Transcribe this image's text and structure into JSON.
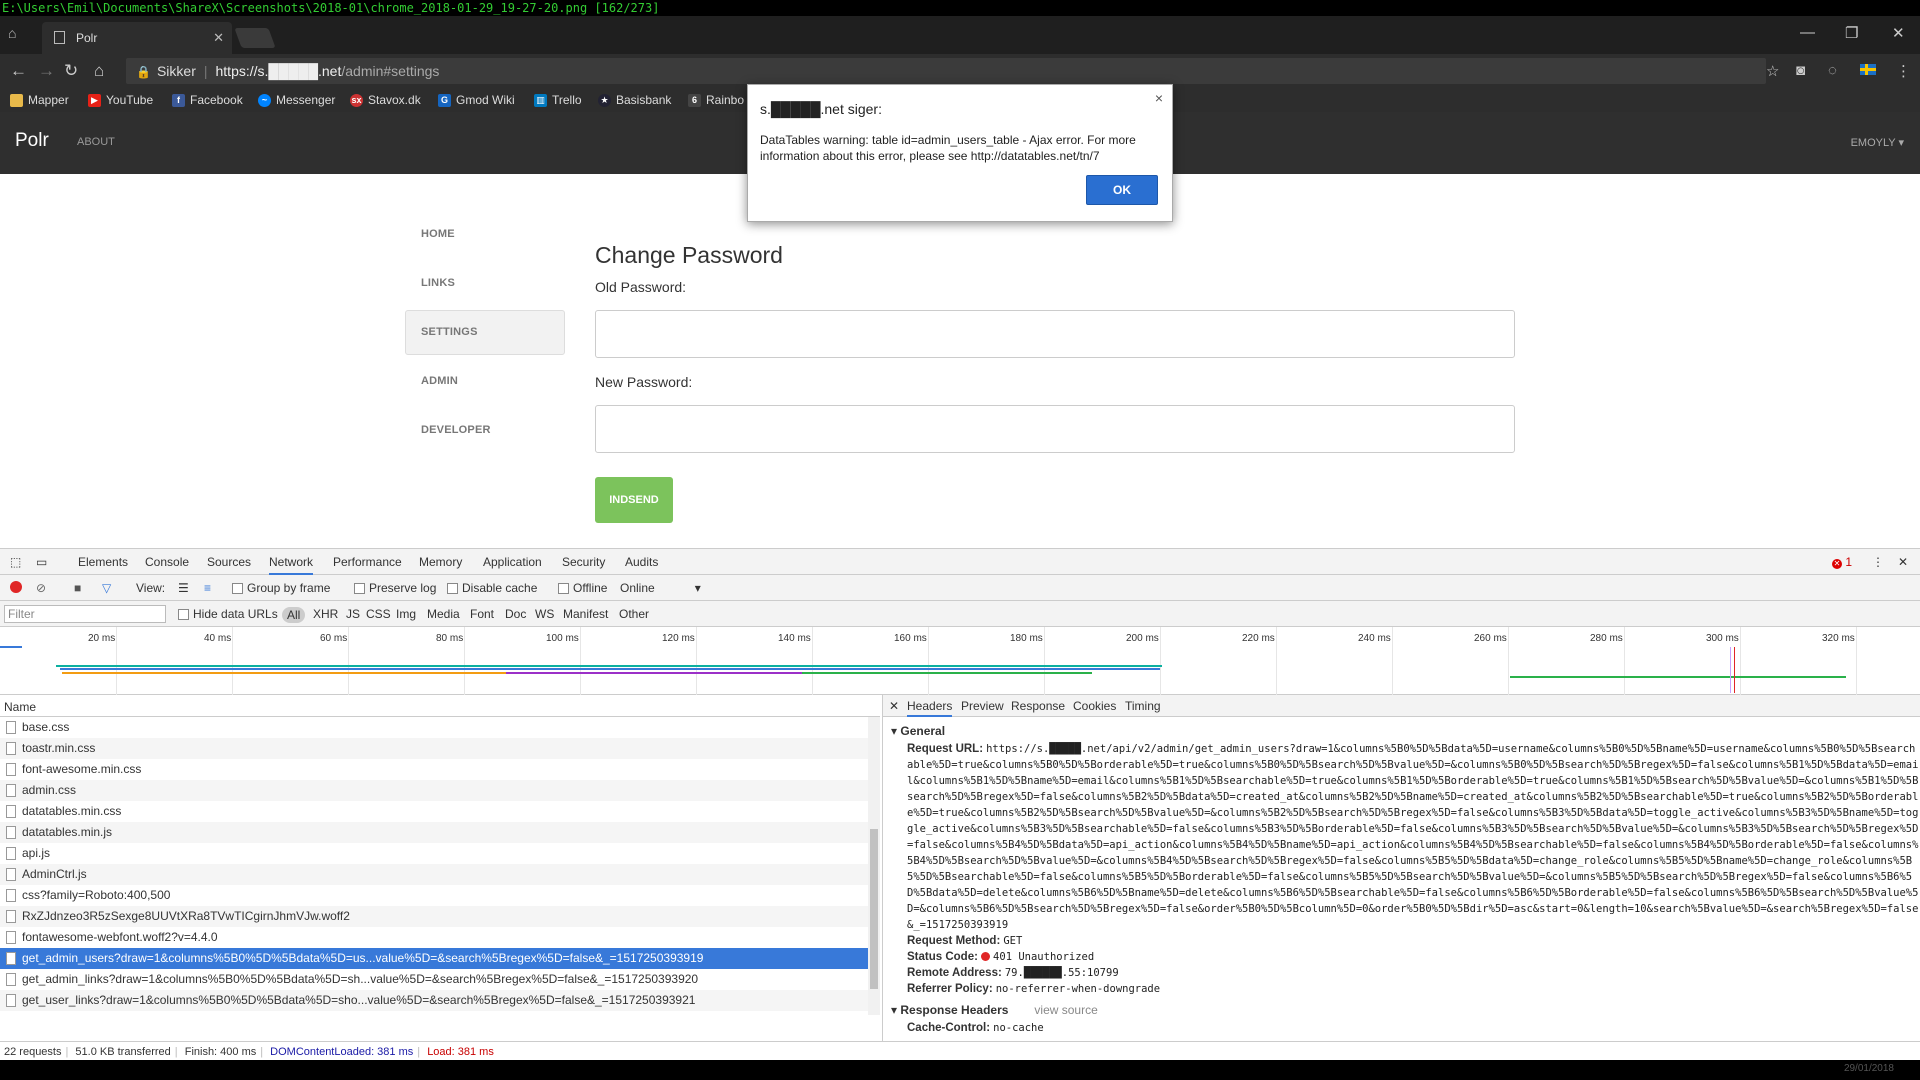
{
  "sharex_title": "E:\\Users\\Emil\\Documents\\ShareX\\Screenshots\\2018-01\\chrome_2018-01-29_19-27-20.png [162/273]",
  "browser": {
    "tab_title": "Polr",
    "tab_close": "✕",
    "secure_label": "Sikker",
    "url_host": "https://s.█████.net",
    "url_path": "/admin#settings",
    "bookmarks": [
      "Mapper",
      "YouTube",
      "Facebook",
      "Messenger",
      "Stavox.dk",
      "Gmod Wiki",
      "Trello",
      "Basisbank",
      "Rainbo"
    ]
  },
  "navbar": {
    "brand": "Polr",
    "about": "ABOUT",
    "user": "EMOYLY ▾"
  },
  "sidebar": {
    "items": [
      {
        "label": "HOME",
        "active": false
      },
      {
        "label": "LINKS",
        "active": false
      },
      {
        "label": "SETTINGS",
        "active": true
      },
      {
        "label": "ADMIN",
        "active": false
      },
      {
        "label": "DEVELOPER",
        "active": false
      }
    ]
  },
  "settings": {
    "title": "Change Password",
    "old_label": "Old Password:",
    "new_label": "New Password:",
    "submit": "INDSEND"
  },
  "dialog": {
    "title": "s.█████.net siger:",
    "close": "×",
    "message": "DataTables warning: table id=admin_users_table - Ajax error. For more information about this error, please see http://datatables.net/tn/7",
    "ok": "OK"
  },
  "devtools": {
    "tabs": [
      "Elements",
      "Console",
      "Sources",
      "Network",
      "Performance",
      "Memory",
      "Application",
      "Security",
      "Audits"
    ],
    "active_tab": "Network",
    "error_count": "1",
    "toolbar": {
      "view": "View:",
      "group_by_frame": "Group by frame",
      "preserve_log": "Preserve log",
      "disable_cache": "Disable cache",
      "offline": "Offline",
      "throttle": "Online"
    },
    "filter": {
      "placeholder": "Filter",
      "hide_data_urls": "Hide data URLs",
      "types": [
        "All",
        "XHR",
        "JS",
        "CSS",
        "Img",
        "Media",
        "Font",
        "Doc",
        "WS",
        "Manifest",
        "Other"
      ]
    },
    "timeline_ticks": [
      "20 ms",
      "40 ms",
      "60 ms",
      "80 ms",
      "100 ms",
      "120 ms",
      "140 ms",
      "160 ms",
      "180 ms",
      "200 ms",
      "220 ms",
      "240 ms",
      "260 ms",
      "280 ms",
      "300 ms",
      "320 ms"
    ],
    "list_header": "Name",
    "requests": [
      "base.css",
      "toastr.min.css",
      "font-awesome.min.css",
      "admin.css",
      "datatables.min.css",
      "datatables.min.js",
      "api.js",
      "AdminCtrl.js",
      "css?family=Roboto:400,500",
      "RxZJdnzeo3R5zSexge8UUVtXRa8TVwTICgirnJhmVJw.woff2",
      "fontawesome-webfont.woff2?v=4.4.0",
      "get_admin_users?draw=1&columns%5B0%5D%5Bdata%5D=us...value%5D=&search%5Bregex%5D=false&_=1517250393919",
      "get_admin_links?draw=1&columns%5B0%5D%5Bdata%5D=sh...value%5D=&search%5Bregex%5D=false&_=1517250393920",
      "get_user_links?draw=1&columns%5B0%5D%5Bdata%5D=sho...value%5D=&search%5Bregex%5D=false&_=1517250393921"
    ],
    "selected_request": 11,
    "summary": {
      "requests": "22 requests",
      "transferred": "51.0 KB transferred",
      "finish": "Finish: 400 ms",
      "domcontentloaded": "DOMContentLoaded: 381 ms",
      "load": "Load: 381 ms"
    },
    "detail": {
      "tabs": [
        "Headers",
        "Preview",
        "Response",
        "Cookies",
        "Timing"
      ],
      "general_title": "General",
      "request_url_label": "Request URL:",
      "request_url": "https://s.█████.net/api/v2/admin/get_admin_users?draw=1&columns%5B0%5D%5Bdata%5D=username&columns%5B0%5D%5Bname%5D=username&columns%5B0%5D%5Bsearchable%5D=true&columns%5B0%5D%5Borderable%5D=true&columns%5B0%5D%5Bsearch%5D%5Bvalue%5D=&columns%5B0%5D%5Bsearch%5D%5Bregex%5D=false&columns%5B1%5D%5Bdata%5D=email&columns%5B1%5D%5Bname%5D=email&columns%5B1%5D%5Bsearchable%5D=true&columns%5B1%5D%5Borderable%5D=true&columns%5B1%5D%5Bsearch%5D%5Bvalue%5D=&columns%5B1%5D%5Bsearch%5D%5Bregex%5D=false&columns%5B2%5D%5Bdata%5D=created_at&columns%5B2%5D%5Bname%5D=created_at&columns%5B2%5D%5Bsearchable%5D=true&columns%5B2%5D%5Borderable%5D=true&columns%5B2%5D%5Bsearch%5D%5Bvalue%5D=&columns%5B2%5D%5Bsearch%5D%5Bregex%5D=false&columns%5B3%5D%5Bdata%5D=toggle_active&columns%5B3%5D%5Bname%5D=toggle_active&columns%5B3%5D%5Bsearchable%5D=false&columns%5B3%5D%5Borderable%5D=false&columns%5B3%5D%5Bsearch%5D%5Bvalue%5D=&columns%5B3%5D%5Bsearch%5D%5Bregex%5D=false&columns%5B4%5D%5Bdata%5D=api_action&columns%5B4%5D%5Bname%5D=api_action&columns%5B4%5D%5Bsearchable%5D=false&columns%5B4%5D%5Borderable%5D=false&columns%5B4%5D%5Bsearch%5D%5Bvalue%5D=&columns%5B4%5D%5Bsearch%5D%5Bregex%5D=false&columns%5B5%5D%5Bdata%5D=change_role&columns%5B5%5D%5Bname%5D=change_role&columns%5B5%5D%5Bsearchable%5D=false&columns%5B5%5D%5Borderable%5D=false&columns%5B5%5D%5Bsearch%5D%5Bvalue%5D=&columns%5B5%5D%5Bsearch%5D%5Bregex%5D=false&columns%5B6%5D%5Bdata%5D=delete&columns%5B6%5D%5Bname%5D=delete&columns%5B6%5D%5Bsearchable%5D=false&columns%5B6%5D%5Borderable%5D=false&columns%5B6%5D%5Bsearch%5D%5Bvalue%5D=&columns%5B6%5D%5Bsearch%5D%5Bregex%5D=false&order%5B0%5D%5Bcolumn%5D=0&order%5B0%5D%5Bdir%5D=asc&start=0&length=10&search%5Bvalue%5D=&search%5Bregex%5D=false&_=1517250393919",
      "request_method_label": "Request Method:",
      "request_method": "GET",
      "status_code_label": "Status Code:",
      "status_code": "401 Unauthorized",
      "remote_address_label": "Remote Address:",
      "remote_address": "79.██████.55:10799",
      "referrer_policy_label": "Referrer Policy:",
      "referrer_policy": "no-referrer-when-downgrade",
      "response_headers_title": "Response Headers",
      "view_source": "view source",
      "cache_control_label": "Cache-Control:",
      "cache_control": "no-cache"
    }
  },
  "taskbar_date": "29/01/2018"
}
